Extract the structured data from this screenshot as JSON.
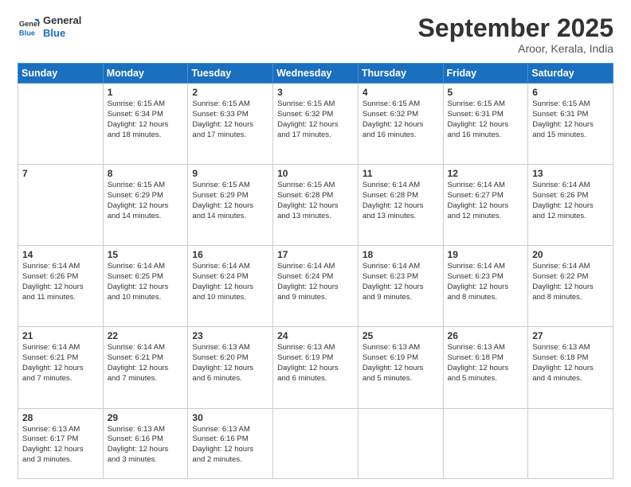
{
  "logo": {
    "line1": "General",
    "line2": "Blue"
  },
  "header": {
    "month": "September 2025",
    "location": "Aroor, Kerala, India"
  },
  "weekdays": [
    "Sunday",
    "Monday",
    "Tuesday",
    "Wednesday",
    "Thursday",
    "Friday",
    "Saturday"
  ],
  "weeks": [
    [
      {
        "day": "",
        "info": ""
      },
      {
        "day": "1",
        "info": "Sunrise: 6:15 AM\nSunset: 6:34 PM\nDaylight: 12 hours\nand 18 minutes."
      },
      {
        "day": "2",
        "info": "Sunrise: 6:15 AM\nSunset: 6:33 PM\nDaylight: 12 hours\nand 17 minutes."
      },
      {
        "day": "3",
        "info": "Sunrise: 6:15 AM\nSunset: 6:32 PM\nDaylight: 12 hours\nand 17 minutes."
      },
      {
        "day": "4",
        "info": "Sunrise: 6:15 AM\nSunset: 6:32 PM\nDaylight: 12 hours\nand 16 minutes."
      },
      {
        "day": "5",
        "info": "Sunrise: 6:15 AM\nSunset: 6:31 PM\nDaylight: 12 hours\nand 16 minutes."
      },
      {
        "day": "6",
        "info": "Sunrise: 6:15 AM\nSunset: 6:31 PM\nDaylight: 12 hours\nand 15 minutes."
      }
    ],
    [
      {
        "day": "7",
        "info": ""
      },
      {
        "day": "8",
        "info": "Sunrise: 6:15 AM\nSunset: 6:29 PM\nDaylight: 12 hours\nand 14 minutes."
      },
      {
        "day": "9",
        "info": "Sunrise: 6:15 AM\nSunset: 6:29 PM\nDaylight: 12 hours\nand 14 minutes."
      },
      {
        "day": "10",
        "info": "Sunrise: 6:15 AM\nSunset: 6:28 PM\nDaylight: 12 hours\nand 13 minutes."
      },
      {
        "day": "11",
        "info": "Sunrise: 6:14 AM\nSunset: 6:28 PM\nDaylight: 12 hours\nand 13 minutes."
      },
      {
        "day": "12",
        "info": "Sunrise: 6:14 AM\nSunset: 6:27 PM\nDaylight: 12 hours\nand 12 minutes."
      },
      {
        "day": "13",
        "info": "Sunrise: 6:14 AM\nSunset: 6:26 PM\nDaylight: 12 hours\nand 12 minutes."
      }
    ],
    [
      {
        "day": "14",
        "info": "Sunrise: 6:14 AM\nSunset: 6:26 PM\nDaylight: 12 hours\nand 11 minutes."
      },
      {
        "day": "15",
        "info": "Sunrise: 6:14 AM\nSunset: 6:25 PM\nDaylight: 12 hours\nand 10 minutes."
      },
      {
        "day": "16",
        "info": "Sunrise: 6:14 AM\nSunset: 6:24 PM\nDaylight: 12 hours\nand 10 minutes."
      },
      {
        "day": "17",
        "info": "Sunrise: 6:14 AM\nSunset: 6:24 PM\nDaylight: 12 hours\nand 9 minutes."
      },
      {
        "day": "18",
        "info": "Sunrise: 6:14 AM\nSunset: 6:23 PM\nDaylight: 12 hours\nand 9 minutes."
      },
      {
        "day": "19",
        "info": "Sunrise: 6:14 AM\nSunset: 6:23 PM\nDaylight: 12 hours\nand 8 minutes."
      },
      {
        "day": "20",
        "info": "Sunrise: 6:14 AM\nSunset: 6:22 PM\nDaylight: 12 hours\nand 8 minutes."
      }
    ],
    [
      {
        "day": "21",
        "info": "Sunrise: 6:14 AM\nSunset: 6:21 PM\nDaylight: 12 hours\nand 7 minutes."
      },
      {
        "day": "22",
        "info": "Sunrise: 6:14 AM\nSunset: 6:21 PM\nDaylight: 12 hours\nand 7 minutes."
      },
      {
        "day": "23",
        "info": "Sunrise: 6:13 AM\nSunset: 6:20 PM\nDaylight: 12 hours\nand 6 minutes."
      },
      {
        "day": "24",
        "info": "Sunrise: 6:13 AM\nSunset: 6:19 PM\nDaylight: 12 hours\nand 6 minutes."
      },
      {
        "day": "25",
        "info": "Sunrise: 6:13 AM\nSunset: 6:19 PM\nDaylight: 12 hours\nand 5 minutes."
      },
      {
        "day": "26",
        "info": "Sunrise: 6:13 AM\nSunset: 6:18 PM\nDaylight: 12 hours\nand 5 minutes."
      },
      {
        "day": "27",
        "info": "Sunrise: 6:13 AM\nSunset: 6:18 PM\nDaylight: 12 hours\nand 4 minutes."
      }
    ],
    [
      {
        "day": "28",
        "info": "Sunrise: 6:13 AM\nSunset: 6:17 PM\nDaylight: 12 hours\nand 3 minutes."
      },
      {
        "day": "29",
        "info": "Sunrise: 6:13 AM\nSunset: 6:16 PM\nDaylight: 12 hours\nand 3 minutes."
      },
      {
        "day": "30",
        "info": "Sunrise: 6:13 AM\nSunset: 6:16 PM\nDaylight: 12 hours\nand 2 minutes."
      },
      {
        "day": "",
        "info": ""
      },
      {
        "day": "",
        "info": ""
      },
      {
        "day": "",
        "info": ""
      },
      {
        "day": "",
        "info": ""
      }
    ]
  ]
}
